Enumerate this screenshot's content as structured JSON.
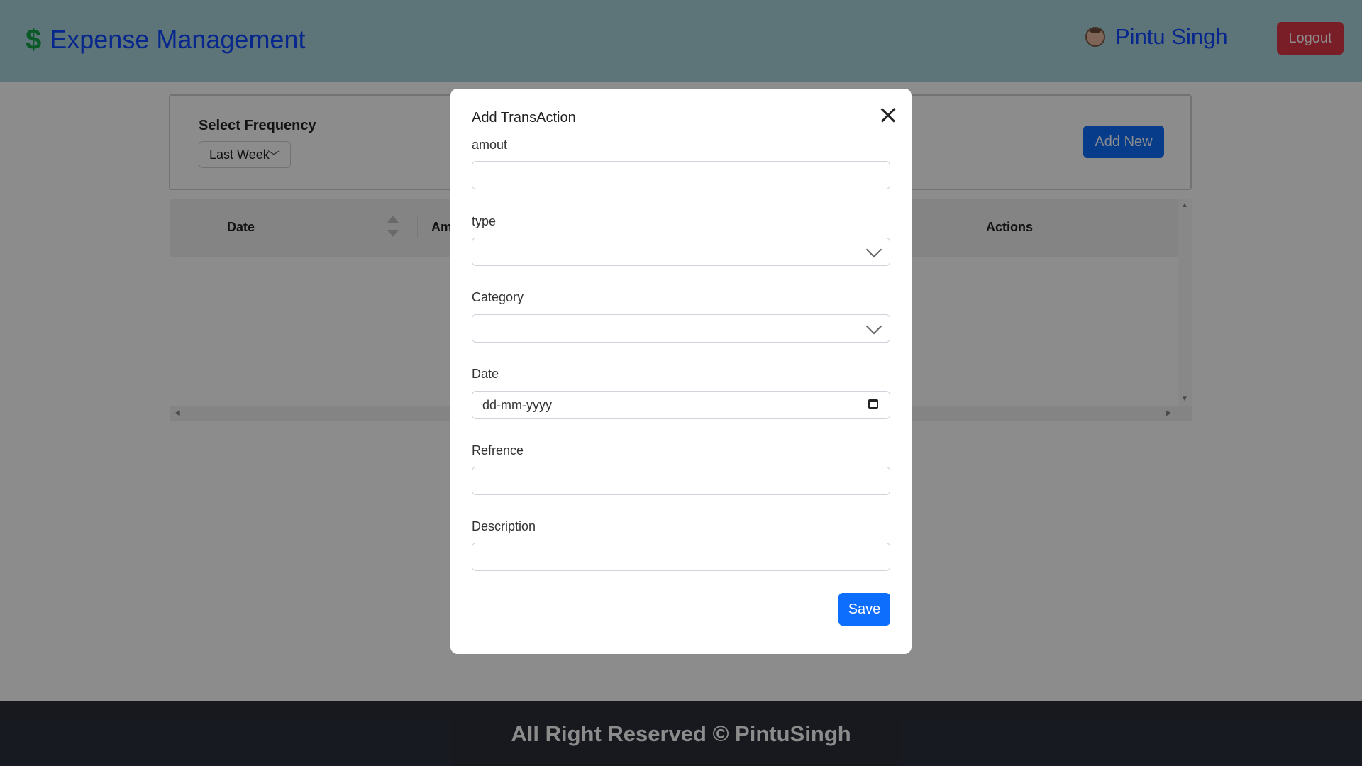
{
  "navbar": {
    "brand_icon": "$",
    "brand_title": "Expense Management",
    "user_name": "Pintu Singh",
    "logout_label": "Logout"
  },
  "filters": {
    "frequency_label": "Select Frequency",
    "frequency_value": "Last Week",
    "add_new_label": "Add New"
  },
  "table": {
    "columns": [
      "Date",
      "Am",
      "Actions"
    ]
  },
  "modal": {
    "title": "Add TransAction",
    "fields": {
      "amount_label": "amout",
      "type_label": "type",
      "category_label": "Category",
      "date_label": "Date",
      "date_placeholder": "dd-mm-yyyy",
      "reference_label": "Refrence",
      "description_label": "Description"
    },
    "save_label": "Save"
  },
  "footer": {
    "text": "All Right Reserved © PintuSingh"
  },
  "colors": {
    "navbar_bg": "#a9d6db",
    "brand": "#0d47ff",
    "brand_icon": "#16a34a",
    "logout": "#dc3545",
    "primary": "#0d6efd",
    "footer_bg": "#2a2f3a"
  }
}
